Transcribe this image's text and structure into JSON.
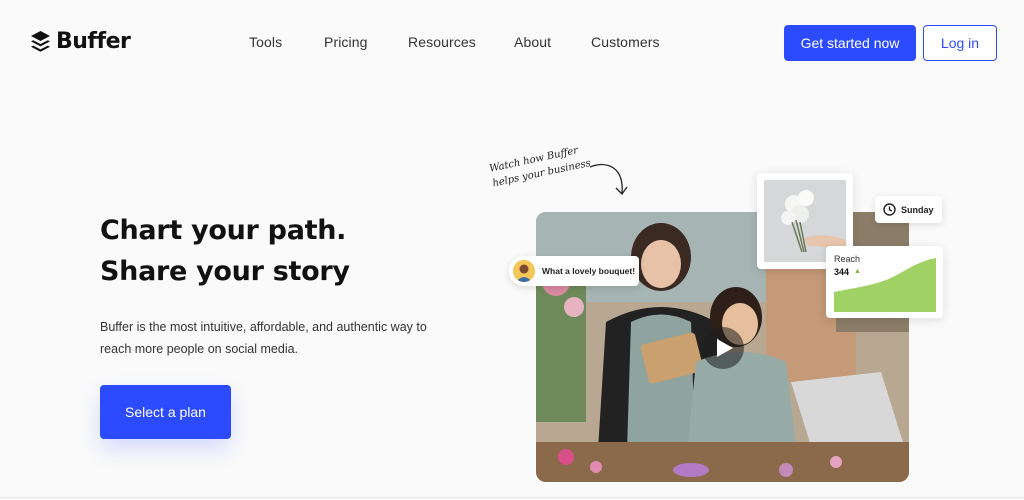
{
  "brand": {
    "name": "Buffer",
    "logo_icon": "buffer-stack-icon"
  },
  "nav": {
    "items": [
      {
        "label": "Tools"
      },
      {
        "label": "Pricing"
      },
      {
        "label": "Resources"
      },
      {
        "label": "About"
      },
      {
        "label": "Customers"
      }
    ],
    "get_started_label": "Get started now",
    "login_label": "Log in"
  },
  "hero": {
    "headline_line1": "Chart your path.",
    "headline_line2": "Share your story",
    "subtext": "Buffer is the most intuitive, affordable, and authentic way to reach more people on social media.",
    "cta_label": "Select a plan",
    "handwritten_note": "Watch how Buffer helps your business",
    "video_play_icon": "play-icon",
    "comment_text": "What a lovely bouquet!",
    "schedule_day": "Sunday",
    "reach_label": "Reach",
    "reach_value": "344",
    "reach_trend_icon": "triangle-up-icon"
  },
  "colors": {
    "accent": "#2c4bff",
    "background": "#fafafa",
    "reach_green": "#9fd165"
  }
}
